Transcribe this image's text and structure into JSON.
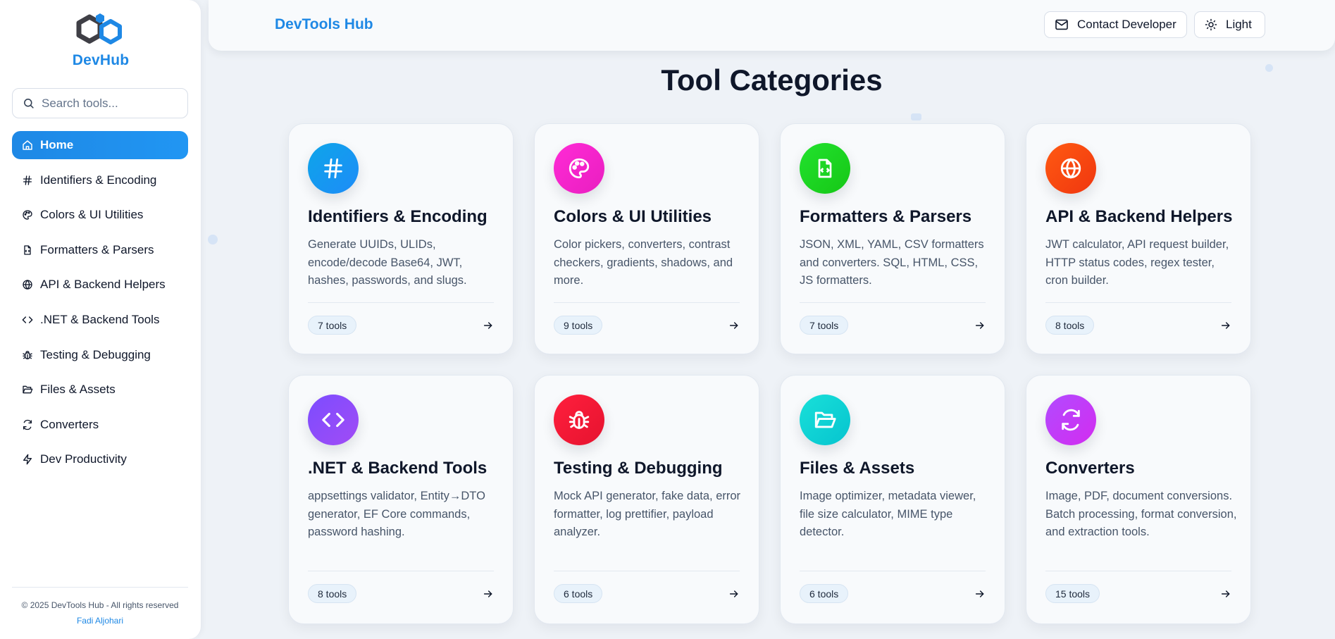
{
  "sidebar": {
    "logo_text": "DevHub",
    "search_placeholder": "Search tools...",
    "nav": [
      {
        "label": "Home",
        "icon": "home-icon",
        "active": true
      },
      {
        "label": "Identifiers & Encoding",
        "icon": "hash-icon"
      },
      {
        "label": "Colors & UI Utilities",
        "icon": "palette-icon"
      },
      {
        "label": "Formatters & Parsers",
        "icon": "file-code-icon"
      },
      {
        "label": "API & Backend Helpers",
        "icon": "globe-icon"
      },
      {
        "label": ".NET & Backend Tools",
        "icon": "code-icon"
      },
      {
        "label": "Testing & Debugging",
        "icon": "bug-icon"
      },
      {
        "label": "Files & Assets",
        "icon": "folder-open-icon"
      },
      {
        "label": "Converters",
        "icon": "refresh-icon"
      },
      {
        "label": "Dev Productivity",
        "icon": "zap-icon"
      }
    ],
    "footer": {
      "copyright": "© 2025 DevTools Hub - All rights reserved",
      "author": "Fadi Aljohari"
    }
  },
  "header": {
    "brand": "DevTools Hub",
    "contact_label": "Contact Developer",
    "theme_label": "Light"
  },
  "main": {
    "title": "Tool Categories",
    "cards": [
      {
        "title": "Identifiers & Encoding",
        "desc": "Generate UUIDs, ULIDs, encode/decode Base64, JWT, hashes, passwords, and slugs.",
        "count": "7 tools",
        "icon": "hash-icon",
        "color_from": "#0ea5e9",
        "color_to": "#1d8cf8"
      },
      {
        "title": "Colors & UI Utilities",
        "desc": "Color pickers, converters, contrast checkers, gradients, shadows, and more.",
        "count": "9 tools",
        "icon": "palette-icon",
        "color_from": "#ff2bd6",
        "color_to": "#e91ec0"
      },
      {
        "title": "Formatters & Parsers",
        "desc": "JSON, XML, YAML, CSV formatters and converters. SQL, HTML, CSS, JS formatters.",
        "count": "7 tools",
        "icon": "file-code-icon",
        "color_from": "#22e22e",
        "color_to": "#16c716"
      },
      {
        "title": "API & Backend Helpers",
        "desc": "JWT calculator, API request builder, HTTP status codes, regex tester, cron builder.",
        "count": "8 tools",
        "icon": "globe-icon",
        "color_from": "#ff5a12",
        "color_to": "#f0360f"
      },
      {
        "title": ".NET & Backend Tools",
        "desc": "appsettings validator, Entity→DTO generator, EF Core commands, password hashing.",
        "count": "8 tools",
        "icon": "code-icon",
        "color_from": "#7c4dff",
        "color_to": "#a14bf5"
      },
      {
        "title": "Testing & Debugging",
        "desc": "Mock API generator, fake data, error formatter, log prettifier, payload analyzer.",
        "count": "6 tools",
        "icon": "bug-icon",
        "color_from": "#ff1f3d",
        "color_to": "#e6132f"
      },
      {
        "title": "Files & Assets",
        "desc": "Image optimizer, metadata viewer, file size calculator, MIME type detector.",
        "count": "6 tools",
        "icon": "folder-open-icon",
        "color_from": "#19e0d9",
        "color_to": "#06c4cf"
      },
      {
        "title": "Converters",
        "desc": "Image, PDF, document conversions. Batch processing, format conversion, and extraction tools.",
        "count": "15 tools",
        "icon": "refresh-icon",
        "color_from": "#b14bff",
        "color_to": "#d32cf0"
      }
    ]
  }
}
